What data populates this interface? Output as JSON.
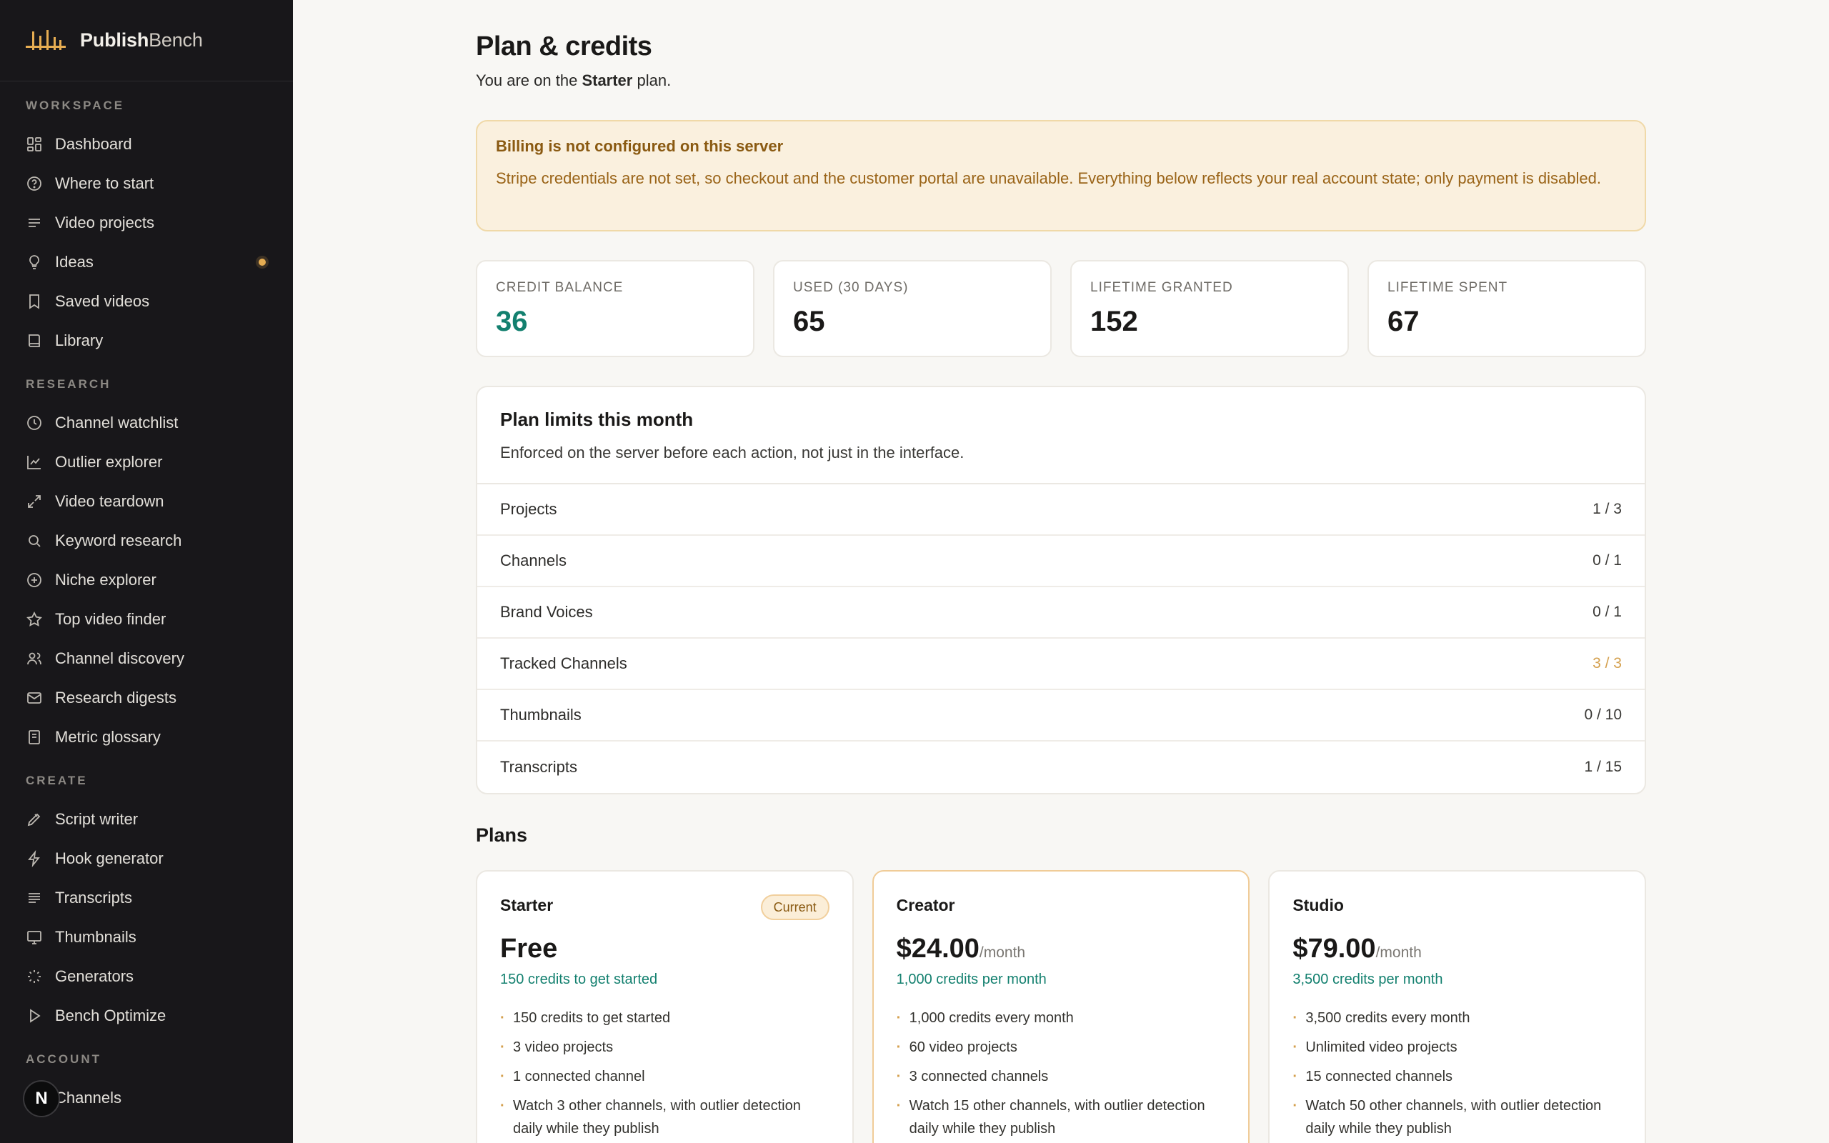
{
  "brand": {
    "name_bold": "Publish",
    "name_rest": "Bench"
  },
  "sidebar": {
    "sections": [
      {
        "heading": "WORKSPACE",
        "items": [
          {
            "label": "Dashboard",
            "icon": "grid-icon"
          },
          {
            "label": "Where to start",
            "icon": "help-circle-icon"
          },
          {
            "label": "Video projects",
            "icon": "list-icon"
          },
          {
            "label": "Ideas",
            "icon": "lightbulb-icon",
            "dot": true
          },
          {
            "label": "Saved videos",
            "icon": "bookmark-icon"
          },
          {
            "label": "Library",
            "icon": "book-icon"
          }
        ]
      },
      {
        "heading": "RESEARCH",
        "items": [
          {
            "label": "Channel watchlist",
            "icon": "clock-icon"
          },
          {
            "label": "Outlier explorer",
            "icon": "line-chart-icon"
          },
          {
            "label": "Video teardown",
            "icon": "expand-icon"
          },
          {
            "label": "Keyword research",
            "icon": "search-icon"
          },
          {
            "label": "Niche explorer",
            "icon": "plus-circle-icon"
          },
          {
            "label": "Top video finder",
            "icon": "star-icon"
          },
          {
            "label": "Channel discovery",
            "icon": "users-icon"
          },
          {
            "label": "Research digests",
            "icon": "mail-icon"
          },
          {
            "label": "Metric glossary",
            "icon": "notebook-icon"
          }
        ]
      },
      {
        "heading": "CREATE",
        "items": [
          {
            "label": "Script writer",
            "icon": "pen-icon"
          },
          {
            "label": "Hook generator",
            "icon": "zap-icon"
          },
          {
            "label": "Transcripts",
            "icon": "text-lines-icon"
          },
          {
            "label": "Thumbnails",
            "icon": "monitor-icon"
          },
          {
            "label": "Generators",
            "icon": "loader-icon"
          },
          {
            "label": "Bench Optimize",
            "icon": "play-icon"
          }
        ]
      },
      {
        "heading": "ACCOUNT",
        "items": [
          {
            "label": "Channels",
            "icon": "channels-icon"
          }
        ]
      }
    ]
  },
  "badge_letter": "N",
  "page": {
    "title": "Plan & credits",
    "sub_prefix": "You are on the ",
    "sub_plan": "Starter",
    "sub_suffix": " plan."
  },
  "alert": {
    "title": "Billing is not configured on this server",
    "body": "Stripe credentials are not set, so checkout and the customer portal are unavailable. Everything below reflects your real account state; only payment is disabled."
  },
  "stats": [
    {
      "label": "CREDIT BALANCE",
      "value": "36"
    },
    {
      "label": "USED (30 DAYS)",
      "value": "65"
    },
    {
      "label": "LIFETIME GRANTED",
      "value": "152"
    },
    {
      "label": "LIFETIME SPENT",
      "value": "67"
    }
  ],
  "limits": {
    "title": "Plan limits this month",
    "subtitle": "Enforced on the server before each action, not just in the interface.",
    "rows": [
      {
        "label": "Projects",
        "value": "1 / 3"
      },
      {
        "label": "Channels",
        "value": "0 / 1"
      },
      {
        "label": "Brand Voices",
        "value": "0 / 1"
      },
      {
        "label": "Tracked Channels",
        "value": "3 / 3",
        "at_limit": true
      },
      {
        "label": "Thumbnails",
        "value": "0 / 10"
      },
      {
        "label": "Transcripts",
        "value": "1 / 15"
      }
    ]
  },
  "plans_title": "Plans",
  "plans": [
    {
      "name": "Starter",
      "badge": "Current",
      "price": "Free",
      "period": "",
      "credits": "150 credits to get started",
      "features": [
        "150 credits to get started",
        "3 video projects",
        "1 connected channel",
        "Watch 3 other channels, with outlier detection daily while they publish"
      ]
    },
    {
      "name": "Creator",
      "price": "$24.00",
      "period": "/month",
      "credits": "1,000 credits per month",
      "features": [
        "1,000 credits every month",
        "60 video projects",
        "3 connected channels",
        "Watch 15 other channels, with outlier detection daily while they publish"
      ]
    },
    {
      "name": "Studio",
      "price": "$79.00",
      "period": "/month",
      "credits": "3,500 credits per month",
      "features": [
        "3,500 credits every month",
        "Unlimited video projects",
        "15 connected channels",
        "Watch 50 other channels, with outlier detection daily while they publish"
      ]
    }
  ],
  "colors": {
    "accent": "#e6ad52",
    "teal": "#13806f",
    "sidebar_bg": "#18171a",
    "alert_bg": "#faf0de"
  }
}
